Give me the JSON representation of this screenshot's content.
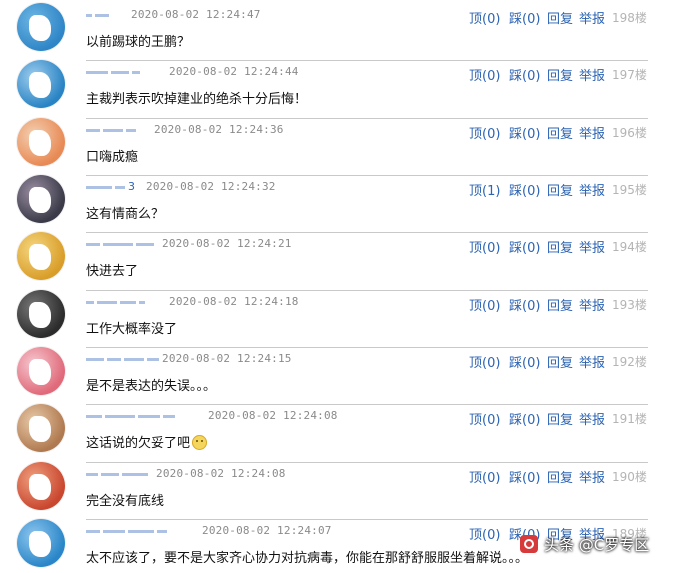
{
  "comments": [
    {
      "user_hint": "",
      "time": "2020-08-02 12:24:47",
      "up": "顶(0)",
      "down": "踩(0)",
      "reply": "回复",
      "report": "举报",
      "floor": "198楼",
      "content": "以前踢球的王鹏？",
      "avatar_colors": [
        "#2f86c7",
        "#6cb5e3"
      ]
    },
    {
      "user_hint": "",
      "time": "2020-08-02 12:24:44",
      "up": "顶(0)",
      "down": "踩(0)",
      "reply": "回复",
      "report": "举报",
      "floor": "197楼",
      "content": "主裁判表示吹掉建业的绝杀十分后悔！",
      "avatar_colors": [
        "#2a84c4",
        "#9ecdee"
      ]
    },
    {
      "user_hint": "",
      "time": "2020-08-02 12:24:36",
      "up": "顶(0)",
      "down": "踩(0)",
      "reply": "回复",
      "report": "举报",
      "floor": "196楼",
      "content": "口嗨成瘾",
      "avatar_colors": [
        "#e88a55",
        "#f3d0b2"
      ]
    },
    {
      "user_hint": "3",
      "time": "2020-08-02 12:24:32",
      "up": "顶(1)",
      "down": "踩(0)",
      "reply": "回复",
      "report": "举报",
      "floor": "195楼",
      "content": "这有情商么？",
      "avatar_colors": [
        "#3a3a48",
        "#9a8ea2"
      ]
    },
    {
      "user_hint": "",
      "time": "2020-08-02 12:24:21",
      "up": "顶(0)",
      "down": "踩(0)",
      "reply": "回复",
      "report": "举报",
      "floor": "194楼",
      "content": "快进去了",
      "avatar_colors": [
        "#d99e2a",
        "#f5d680"
      ]
    },
    {
      "user_hint": "",
      "time": "2020-08-02 12:24:18",
      "up": "顶(0)",
      "down": "踩(0)",
      "reply": "回复",
      "report": "举报",
      "floor": "193楼",
      "content": "工作大概率没了",
      "avatar_colors": [
        "#2c2c2c",
        "#777777"
      ]
    },
    {
      "user_hint": "",
      "time": "2020-08-02 12:24:15",
      "up": "顶(0)",
      "down": "踩(0)",
      "reply": "回复",
      "report": "举报",
      "floor": "192楼",
      "content": "是不是表达的失误。。。",
      "avatar_colors": [
        "#e06a7a",
        "#f6c8d0"
      ]
    },
    {
      "user_hint": "",
      "time": "2020-08-02 12:24:08",
      "up": "顶(0)",
      "down": "踩(0)",
      "reply": "回复",
      "report": "举报",
      "floor": "191楼",
      "content": "这话说的欠妥了吧",
      "avatar_colors": [
        "#b07a50",
        "#e8c9a8"
      ],
      "emoji": true
    },
    {
      "user_hint": "",
      "time": "2020-08-02 12:24:08",
      "up": "顶(0)",
      "down": "踩(0)",
      "reply": "回复",
      "report": "举报",
      "floor": "190楼",
      "content": "完全没有底线",
      "avatar_colors": [
        "#c9472f",
        "#ef9f7e"
      ]
    },
    {
      "user_hint": "",
      "time": "2020-08-02 12:24:07",
      "up": "顶(0)",
      "down": "踩(0)",
      "reply": "回复",
      "report": "举报",
      "floor": "189楼",
      "content": "太不应该了，要不是大家齐心协力对抗病毒，你能在那舒舒服服坐着解说。。。",
      "avatar_colors": [
        "#2a86c8",
        "#8ec6ee"
      ]
    }
  ],
  "watermark": {
    "text": "头条 @C罗专区"
  }
}
